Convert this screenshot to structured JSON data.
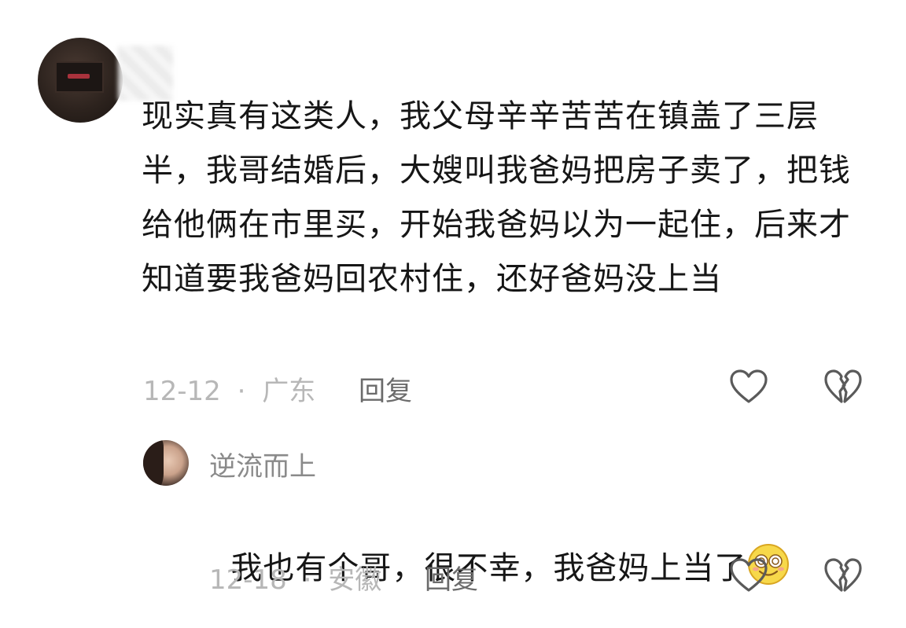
{
  "comment": {
    "text": "现实真有这类人，我父母辛辛苦苦在镇盖了三层半，我哥结婚后，大嫂叫我爸妈把房子卖了，把钱给他俩在市里买，开始我爸妈以为一起住，后来才知道要我爸妈回农村住，还好爸妈没上当",
    "date": "12-12",
    "separator": "·",
    "location": "广东",
    "reply_label": "回复",
    "like_icon": "heart-icon",
    "dislike_icon": "broken-heart-icon"
  },
  "reply": {
    "username": "逆流而上",
    "text": "我也有个哥，很不幸，我爸妈上当了",
    "emoji": "dizzy-face-emoji",
    "date": "12-18",
    "separator": "·",
    "location": "安徽",
    "reply_label": "回复",
    "like_icon": "heart-icon",
    "dislike_icon": "broken-heart-icon"
  },
  "colors": {
    "text": "#161616",
    "meta": "#b7b7b7",
    "reply_action": "#6b6b6b",
    "username": "#8a8a8a",
    "icon_stroke": "#5a5a5a",
    "emoji_fill": "#f7d84a"
  }
}
